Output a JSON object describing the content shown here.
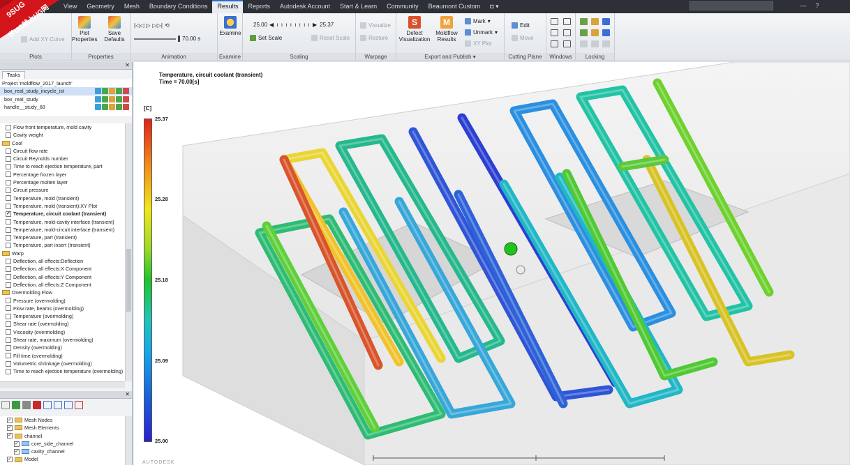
{
  "menu": {
    "tabs": [
      "View",
      "Geometry",
      "Mesh",
      "Boundary Conditions",
      "Results",
      "Reports",
      "Autodesk Account",
      "Start & Learn",
      "Community",
      "Beaumont Custom"
    ],
    "active": "Results"
  },
  "watermark": {
    "line1": "9SUG",
    "line2": "学UG就上UG网"
  },
  "ribbon": {
    "plots": {
      "label": "Plots",
      "add_xy": "Add XY Curve"
    },
    "properties": {
      "label": "Properties",
      "plot_props": "Plot Properties",
      "save_defaults": "Save Defaults"
    },
    "animation": {
      "label": "Animation",
      "time": "70.00 s"
    },
    "examine": {
      "label": "Examine",
      "btn": "Examine"
    },
    "scaling": {
      "label": "Scaling",
      "min": "25.00",
      "max": "25.37",
      "set_scale": "Set Scale",
      "reset_scale": "Reset Scale"
    },
    "warpage": {
      "label": "Warpage",
      "visualize": "Visualize",
      "restore": "Restore"
    },
    "export": {
      "label": "Export and Publish",
      "defect": "Defect Visualization",
      "moldflow": "Moldflow Results",
      "mark": "Mark",
      "unmark": "Unmark",
      "xyplot": "XY Plot"
    },
    "cutting": {
      "label": "Cutting Plane",
      "edit": "Edit",
      "move": "Move"
    },
    "windows": {
      "label": "Windows"
    },
    "locking": {
      "label": "Locking"
    }
  },
  "left_panel": {
    "tab": "Tasks",
    "project": "Project 'moldflow_2017_launch'",
    "studies": [
      {
        "name": "box_real_study_incycle_ist",
        "selected": true
      },
      {
        "name": "box_real_study",
        "selected": false
      },
      {
        "name": "handle__study_68",
        "selected": false
      }
    ],
    "results": [
      {
        "type": "item",
        "label": "Flow front temperature, mold cavity",
        "checked": false
      },
      {
        "type": "item",
        "label": "Cavity weight",
        "checked": false
      },
      {
        "type": "folder",
        "label": "Cool"
      },
      {
        "type": "item",
        "label": "Circuit flow rate",
        "checked": false
      },
      {
        "type": "item",
        "label": "Circuit Reynolds number",
        "checked": false
      },
      {
        "type": "item",
        "label": "Time to reach ejection temperature, part",
        "checked": false
      },
      {
        "type": "item",
        "label": "Percentage frozen layer",
        "checked": false
      },
      {
        "type": "item",
        "label": "Percentage molten layer",
        "checked": false
      },
      {
        "type": "item",
        "label": "Circuit pressure",
        "checked": false
      },
      {
        "type": "item",
        "label": "Temperature, mold (transient)",
        "checked": false
      },
      {
        "type": "item",
        "label": "Temperature, mold (transient):XY Plot",
        "checked": false
      },
      {
        "type": "item",
        "label": "Temperature, circuit coolant (transient)",
        "checked": true,
        "bold": true
      },
      {
        "type": "item",
        "label": "Temperature, mold-cavity interface (transient)",
        "checked": false
      },
      {
        "type": "item",
        "label": "Temperature, mold-circuit interface (transient)",
        "checked": false
      },
      {
        "type": "item",
        "label": "Temperature, part (transient)",
        "checked": false
      },
      {
        "type": "item",
        "label": "Temperature, part insert (transient)",
        "checked": false
      },
      {
        "type": "folder",
        "label": "Warp"
      },
      {
        "type": "item",
        "label": "Deflection, all effects:Deflection",
        "checked": false
      },
      {
        "type": "item",
        "label": "Deflection, all effects:X Component",
        "checked": false
      },
      {
        "type": "item",
        "label": "Deflection, all effects:Y Component",
        "checked": false
      },
      {
        "type": "item",
        "label": "Deflection, all effects:Z Component",
        "checked": false
      },
      {
        "type": "folder",
        "label": "Overmolding Flow"
      },
      {
        "type": "item",
        "label": "Pressure (overmolding)",
        "checked": false
      },
      {
        "type": "item",
        "label": "Flow rate, beams (overmolding)",
        "checked": false
      },
      {
        "type": "item",
        "label": "Temperature (overmolding)",
        "checked": false
      },
      {
        "type": "item",
        "label": "Shear rate (overmolding)",
        "checked": false
      },
      {
        "type": "item",
        "label": "Viscosity (overmolding)",
        "checked": false
      },
      {
        "type": "item",
        "label": "Shear rate, maximum (overmolding)",
        "checked": false
      },
      {
        "type": "item",
        "label": "Density (overmolding)",
        "checked": false
      },
      {
        "type": "item",
        "label": "Fill time (overmolding)",
        "checked": false
      },
      {
        "type": "item",
        "label": "Volumetric shrinkage (overmolding)",
        "checked": false
      },
      {
        "type": "item",
        "label": "Time to reach ejection temperature (overmolding)",
        "checked": false
      }
    ],
    "layers": [
      {
        "label": "Mesh Nodes",
        "checked": true,
        "depth": 1
      },
      {
        "label": "Mesh Elements",
        "checked": true,
        "depth": 1
      },
      {
        "label": "channel",
        "checked": true,
        "depth": 1
      },
      {
        "label": "core_side_channel",
        "checked": true,
        "depth": 2
      },
      {
        "label": "cavity_channel",
        "checked": true,
        "depth": 2
      },
      {
        "label": "Model",
        "checked": true,
        "depth": 1
      }
    ]
  },
  "viewport": {
    "title_line1": "Temperature, circuit coolant (transient)",
    "title_line2": "Time = 70.00[s]",
    "unit": "[C]",
    "legend": [
      "25.37",
      "25.28",
      "25.18",
      "25.09",
      "25.00"
    ],
    "colors": {
      "max": "#e0221b",
      "min": "#2a1fcf",
      "mid": "#1fc32b"
    },
    "brand": "AUTODESK"
  }
}
